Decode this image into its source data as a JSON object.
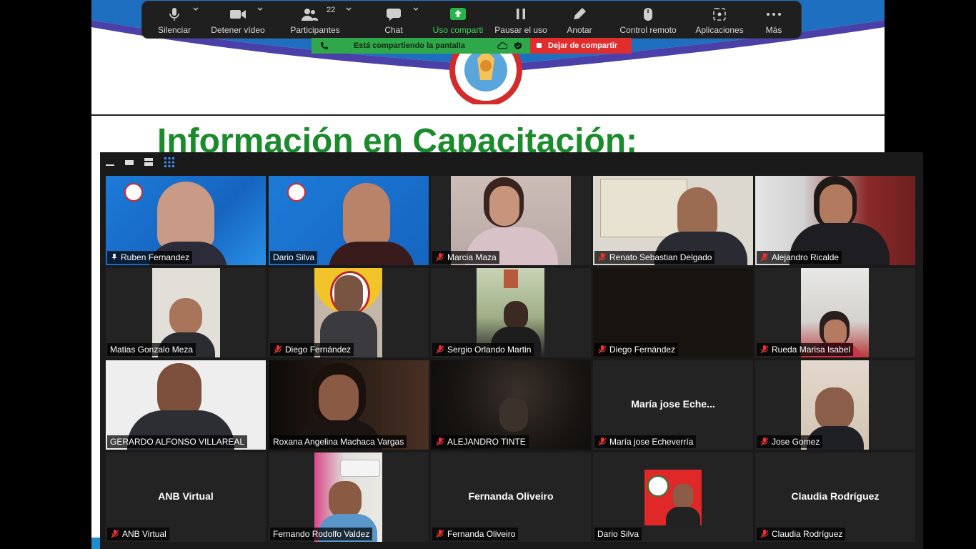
{
  "toolbar": {
    "mute_label": "Silenciar",
    "video_label": "Detener vídeo",
    "participants_label": "Participantes",
    "participants_count": "22",
    "chat_label": "Chat",
    "share_label": "Uso comparti",
    "pause_label": "Pausar el uso",
    "annotate_label": "Anotar",
    "remote_label": "Control remoto",
    "apps_label": "Aplicaciones",
    "more_label": "Más"
  },
  "share_bar": {
    "status_text": "Está compartiendo la pantalla",
    "stop_label": "Dejar de compartir"
  },
  "slide": {
    "title": "Información en Capacitación:"
  },
  "colors": {
    "share_green": "#2ea84a",
    "stop_red": "#e02d2d",
    "slide_title_green": "#1b8a2c",
    "active_speaker": "#e7e36a"
  },
  "participants": [
    {
      "name": "Ruben Fernandez"
    },
    {
      "name": "Dario Silva"
    },
    {
      "name": "Marcia Maza"
    },
    {
      "name": "Renato Sebastian Delgado"
    },
    {
      "name": "Alejandro Ricalde"
    },
    {
      "name": "Matias Gonzalo Meza"
    },
    {
      "name": "Diego Fernández"
    },
    {
      "name": "Sergio Orlando Martin"
    },
    {
      "name": "Diego Fernández"
    },
    {
      "name": "Rueda Marisa Isabel"
    },
    {
      "name": "GERARDO ALFONSO VILLAREAL"
    },
    {
      "name": "Roxana Angelina Machaca Vargas"
    },
    {
      "name": "ALEJANDRO TINTE"
    },
    {
      "name": "María jose Echeverría",
      "display": "María jose Eche..."
    },
    {
      "name": "Jose Gomez"
    },
    {
      "name": "ANB Virtual",
      "display": "ANB Virtual"
    },
    {
      "name": "Fernando Rodolfo Valdez"
    },
    {
      "name": "Fernanda Oliveiro",
      "display": "Fernanda Oliveiro"
    },
    {
      "name": "Dario Silva"
    },
    {
      "name": "Claudia Rodríguez",
      "display": "Claudia Rodríguez"
    }
  ]
}
